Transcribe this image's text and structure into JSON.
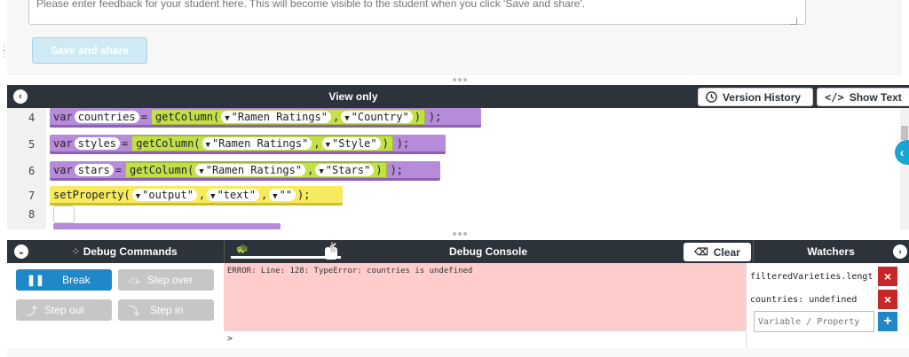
{
  "feedback": {
    "placeholder": "Please enter feedback for your student here. This will become visible to the student when you click 'Save and share'.",
    "save_label": "Save and share"
  },
  "workspace": {
    "title": "View only",
    "version_history_label": "Version History",
    "show_text_label": "Show Text"
  },
  "code": {
    "lines": [
      {
        "num": "4",
        "kw": "var",
        "name": "countries",
        "fn": "getColumn(",
        "a1": "\"Ramen Ratings\"",
        "a2": "\"Country\""
      },
      {
        "num": "5",
        "kw": "var",
        "name": "styles",
        "fn": "getColumn(",
        "a1": "\"Ramen Ratings\"",
        "a2": "\"Style\""
      },
      {
        "num": "6",
        "kw": "var",
        "name": "stars",
        "fn": "getColumn(",
        "a1": "\"Ramen Ratings\"",
        "a2": "\"Stars\""
      }
    ],
    "line7": {
      "num": "7",
      "fn": "setProperty(",
      "a1": "\"output\"",
      "a2": "\"text\"",
      "a3": "\"\"",
      "end": ");"
    },
    "line8": {
      "num": "8"
    },
    "eq": "=",
    "comma": ",",
    "close": ");",
    "close_paren": ")"
  },
  "debug": {
    "commands_title": "Debug Commands",
    "console_title": "Debug Console",
    "clear_label": "Clear",
    "watchers_title": "Watchers",
    "break_label": "Break",
    "step_over_label": "Step over",
    "step_out_label": "Step out",
    "step_in_label": "Step in",
    "console_output": "ERROR: Line: 128: TypeError: countries is undefined",
    "console_prompt": ">",
    "watchers": [
      {
        "expr": "filteredVarieties.length"
      },
      {
        "expr": "countries: undefined"
      }
    ],
    "watch_placeholder": "Variable / Property"
  },
  "colors": {
    "header_bg": "#2d333a",
    "var_block": "#b68bd9",
    "fn_block": "#c1e04a",
    "stmt_block": "#f6ea5e",
    "break_button": "#1e88c8",
    "error_bg": "#ffcccc",
    "remove_watch": "#c62828"
  },
  "icons": {
    "collapse": "chevron-left-icon",
    "version_history": "clock-icon",
    "show_text": "code-icon",
    "clear": "eraser-icon",
    "break": "pause-icon",
    "remove": "close-icon",
    "add": "plus-icon"
  }
}
